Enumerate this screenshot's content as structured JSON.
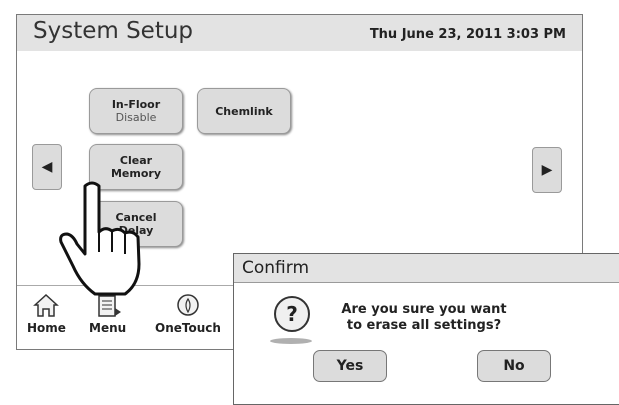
{
  "header": {
    "title": "System Setup",
    "datetime": "Thu June 23, 2011  3:03 PM"
  },
  "buttons": {
    "in_floor": {
      "label": "In-Floor",
      "sub": "Disable"
    },
    "chemlink": {
      "label": "Chemlink"
    },
    "clear_memory": {
      "line1": "Clear",
      "line2": "Memory"
    },
    "cancel_delay": {
      "line1": "Cancel",
      "line2": "Delay"
    }
  },
  "arrows": {
    "left": "◀",
    "right": "▶"
  },
  "nav": {
    "home": "Home",
    "menu": "Menu",
    "onetouch": "OneTouch"
  },
  "dialog": {
    "title": "Confirm",
    "line1": "Are you sure you want",
    "line2": "to erase all settings?",
    "icon": "?",
    "yes": "Yes",
    "no": "No"
  },
  "icons": [
    "home-icon",
    "menu-icon",
    "onetouch-icon",
    "question-icon",
    "pointing-hand-icon"
  ]
}
